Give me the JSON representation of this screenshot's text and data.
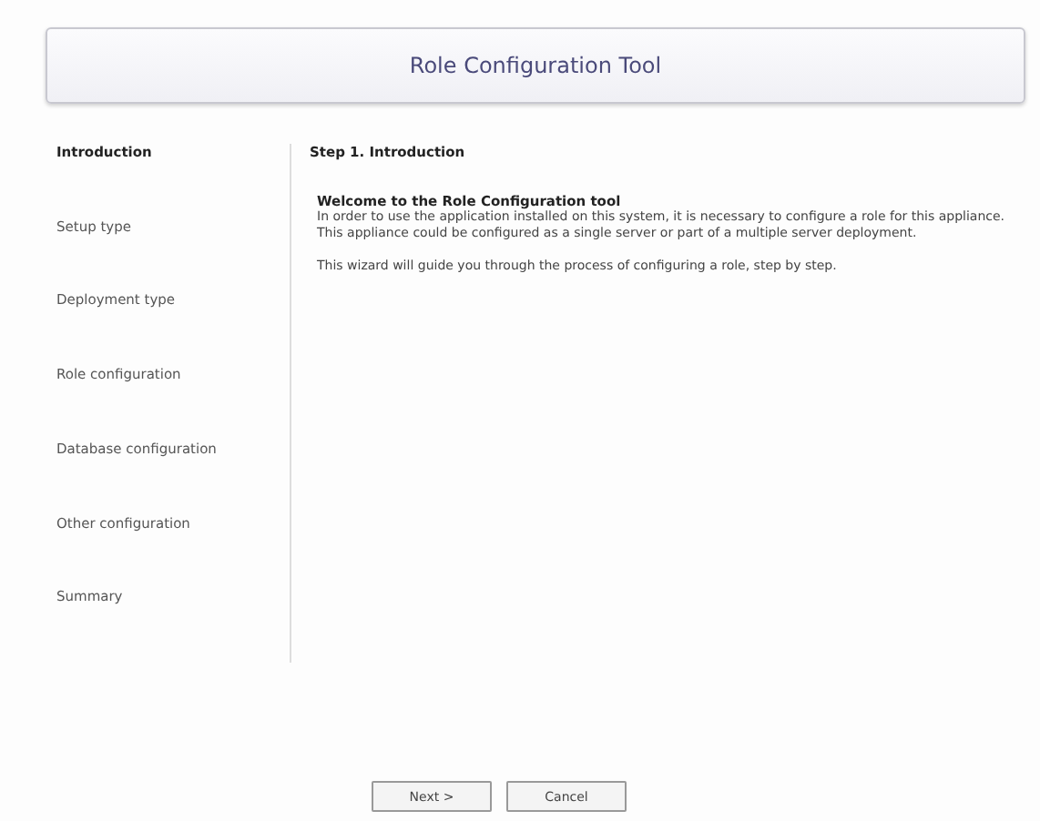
{
  "title": "Role Configuration Tool",
  "steps": [
    {
      "label": "Introduction",
      "selected": true
    },
    {
      "label": "Setup type",
      "selected": false
    },
    {
      "label": "Deployment type",
      "selected": false
    },
    {
      "label": "Role configuration",
      "selected": false
    },
    {
      "label": "Database configuration",
      "selected": false
    },
    {
      "label": "Other configuration",
      "selected": false
    },
    {
      "label": "Summary",
      "selected": false
    }
  ],
  "content": {
    "heading": "Step 1. Introduction",
    "welcome_title": "Welcome to the Role Configuration tool",
    "paragraphs": [
      "In order to use the application installed on this system, it is necessary to configure a role for this appliance. This appliance could be configured as a single server or part of a multiple server deployment.",
      "This wizard will guide you through the process of configuring a role, step by step."
    ]
  },
  "buttons": [
    "Next >",
    "Cancel"
  ]
}
